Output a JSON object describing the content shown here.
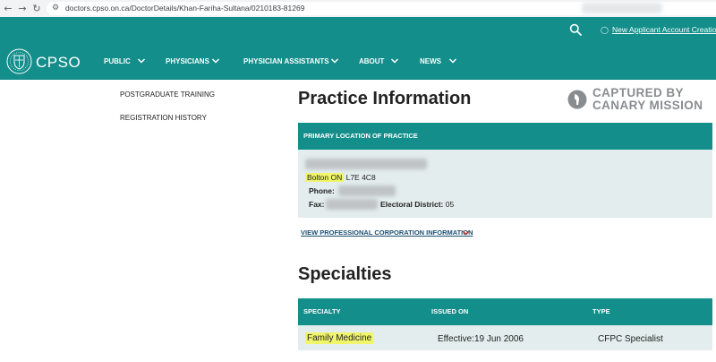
{
  "browser": {
    "url": "doctors.cpso.on.ca/DoctorDetails/Khan-Fariha-Sultana/0210183-81269"
  },
  "header": {
    "account_link": "New Applicant Account Creation",
    "logo_text": "CPSO",
    "nav": [
      {
        "label": "PUBLIC"
      },
      {
        "label": "PHYSICIANS"
      },
      {
        "label": "PHYSICIAN ASSISTANTS"
      },
      {
        "label": "ABOUT"
      },
      {
        "label": "NEWS"
      }
    ],
    "brand_color": "#138e8b"
  },
  "sidebar": {
    "links": [
      {
        "label": "POSTGRADUATE TRAINING"
      },
      {
        "label": "REGISTRATION HISTORY"
      }
    ]
  },
  "watermark": {
    "line1": "CAPTURED BY",
    "line2": "CANARY MISSION"
  },
  "practice": {
    "title": "Practice Information",
    "section_header": "PRIMARY LOCATION OF PRACTICE",
    "city": "Bolton ON",
    "postal": "L7E 4C8",
    "phone_label": "Phone:",
    "fax_label": "Fax:",
    "district_label": "Electoral District:",
    "district_value": "05",
    "corp_link": "VIEW PROFESSIONAL CORPORATION INFORMATION"
  },
  "specialties": {
    "title": "Specialties",
    "columns": [
      "SPECIALTY",
      "ISSUED ON",
      "TYPE"
    ],
    "rows": [
      {
        "specialty": "Family Medicine",
        "issued": "Effective:19 Jun 2006",
        "type": "CFPC Specialist"
      }
    ]
  }
}
